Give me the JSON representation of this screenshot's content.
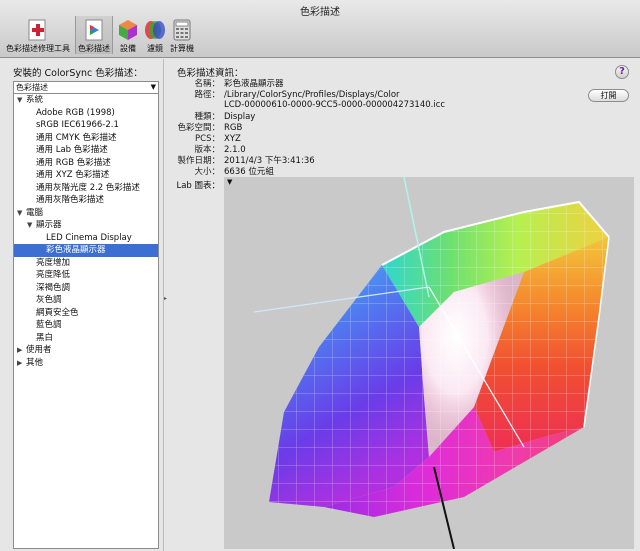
{
  "window": {
    "title": "色彩描述"
  },
  "toolbar": {
    "items": [
      {
        "label": "色彩描述修理工具",
        "icon": "profile-first-aid-icon"
      },
      {
        "label": "色彩描述",
        "icon": "profiles-icon"
      },
      {
        "label": "設備",
        "icon": "devices-icon"
      },
      {
        "label": "濾鏡",
        "icon": "filters-icon"
      },
      {
        "label": "計算機",
        "icon": "calculator-icon"
      }
    ]
  },
  "left": {
    "label": "安裝的 ColorSync 色彩描述：",
    "dropdown_value": "色彩描述",
    "tree": [
      {
        "label": "系統",
        "level": 0,
        "tri": "▼"
      },
      {
        "label": "Adobe RGB (1998)",
        "level": 1
      },
      {
        "label": "sRGB IEC61966-2.1",
        "level": 1
      },
      {
        "label": "通用 CMYK 色彩描述",
        "level": 1
      },
      {
        "label": "通用 Lab 色彩描述",
        "level": 1
      },
      {
        "label": "通用 RGB 色彩描述",
        "level": 1
      },
      {
        "label": "通用 XYZ 色彩描述",
        "level": 1
      },
      {
        "label": "通用灰階光度 2.2 色彩描述",
        "level": 1
      },
      {
        "label": "通用灰階色彩描述",
        "level": 1
      },
      {
        "label": "電腦",
        "level": 0,
        "tri": "▼"
      },
      {
        "label": "顯示器",
        "level": 1,
        "tri": "▼"
      },
      {
        "label": "LED Cinema Display",
        "level": 2
      },
      {
        "label": "彩色液晶顯示器",
        "level": 2,
        "selected": true
      },
      {
        "label": "亮度增加",
        "level": 1
      },
      {
        "label": "亮度降低",
        "level": 1
      },
      {
        "label": "深褐色調",
        "level": 1
      },
      {
        "label": "灰色調",
        "level": 1
      },
      {
        "label": "網頁安全色",
        "level": 1
      },
      {
        "label": "藍色調",
        "level": 1
      },
      {
        "label": "黑白",
        "level": 1
      },
      {
        "label": "使用者",
        "level": 0,
        "tri": "▶"
      },
      {
        "label": "其他",
        "level": 0,
        "tri": "▶"
      }
    ]
  },
  "right": {
    "label": "色彩描述資訊：",
    "help": "?",
    "open_button": "打開",
    "info": [
      {
        "key": "名稱：",
        "value": "彩色液晶顯示器"
      },
      {
        "key": "路徑：",
        "value": "/Library/ColorSync/Profiles/Displays/Color"
      },
      {
        "key": "",
        "value": "LCD-00000610-0000-9CC5-0000-000004273140.icc"
      },
      {
        "key": "種類：",
        "value": "Display"
      },
      {
        "key": "色彩空間：",
        "value": "RGB"
      },
      {
        "key": "PCS：",
        "value": "XYZ"
      },
      {
        "key": "版本：",
        "value": "2.1.0"
      },
      {
        "key": "製作日期：",
        "value": "2011/4/3 下午3:41:36"
      },
      {
        "key": "大小：",
        "value": "6636 位元組"
      }
    ],
    "graph_label": "Lab 圖表："
  }
}
